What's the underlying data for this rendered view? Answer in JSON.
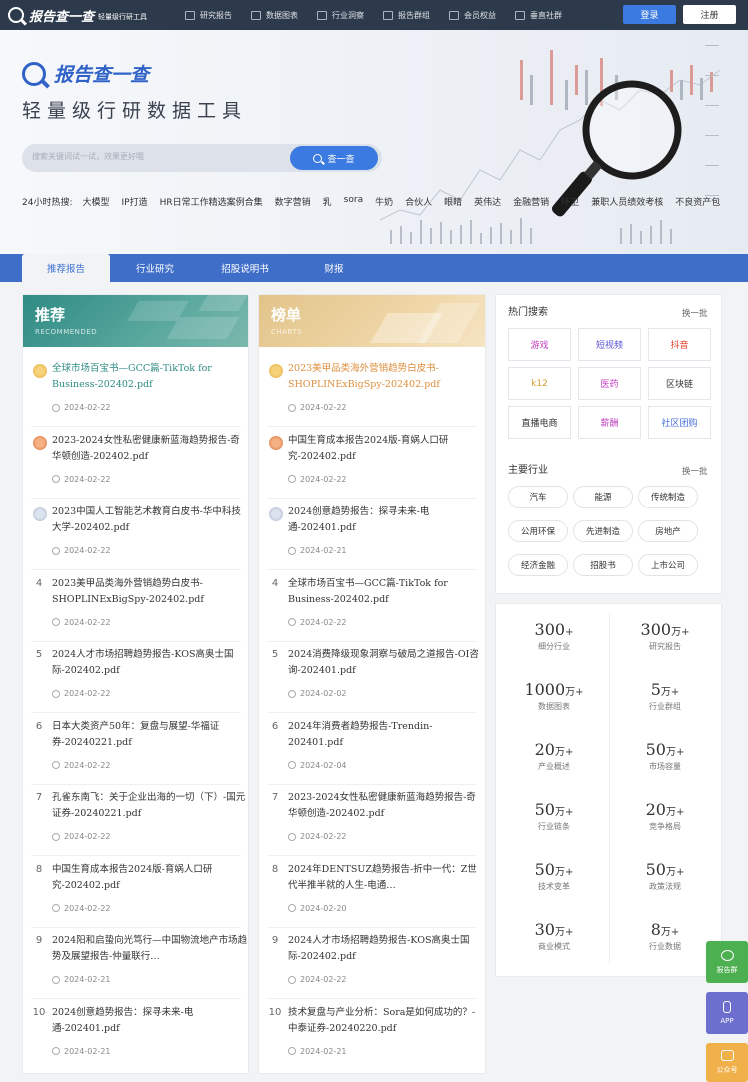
{
  "nav": {
    "logo": "报告查一查",
    "logo_sub": "轻量级行研工具",
    "items": [
      "研究报告",
      "数据图表",
      "行业洞察",
      "报告群组",
      "会员权益",
      "垂直社群"
    ],
    "login": "登录",
    "register": "注册"
  },
  "hero": {
    "brand": "报告查一查",
    "slogan": "轻量级行研数据工具",
    "search_placeholder": "搜索关键词试一试，效果更好哦",
    "search_button": "查一查",
    "hot_label": "24小时热搜:",
    "hot_words": [
      "大模型",
      "IP打造",
      "HR日常工作精选案例合集",
      "数字营销",
      "乳",
      "sora",
      "牛奶",
      "合伙人",
      "眼睛",
      "英伟达",
      "金融营销",
      "环卫",
      "兼职人员绩效考核",
      "不良资产包"
    ]
  },
  "tabs": [
    "推荐报告",
    "行业研究",
    "招股说明书",
    "财报"
  ],
  "recommend": {
    "title": "推荐",
    "subtitle": "RECOMMENDED",
    "items": [
      {
        "rank": "1",
        "title": "全球市场百宝书—GCC篇-TikTok for Business-202402.pdf",
        "date": "2024-02-22"
      },
      {
        "rank": "2",
        "title": "2023-2024女性私密健康新蓝海趋势报告-奇华顿创造-202402.pdf",
        "date": "2024-02-22"
      },
      {
        "rank": "3",
        "title": "2023中国人工智能艺术教育白皮书-华中科技大学-202402.pdf",
        "date": "2024-02-22"
      },
      {
        "rank": "4",
        "title": "2023美甲品类海外营销趋势白皮书-SHOPLINExBigSpy-202402.pdf",
        "date": "2024-02-22"
      },
      {
        "rank": "5",
        "title": "2024人才市场招聘趋势报告-KOS高奥士国际-202402.pdf",
        "date": "2024-02-22"
      },
      {
        "rank": "6",
        "title": "日本大类资产50年：复盘与展望-华福证券-20240221.pdf",
        "date": "2024-02-22"
      },
      {
        "rank": "7",
        "title": "孔雀东南飞：关于企业出海的一切（下）-国元证券-20240221.pdf",
        "date": "2024-02-22"
      },
      {
        "rank": "8",
        "title": "中国生育成本报告2024版-育娲人口研究-202402.pdf",
        "date": "2024-02-22"
      },
      {
        "rank": "9",
        "title": "2024阳和启蛰向光笃行—中国物流地产市场趋势及展望报告-仲量联行…",
        "date": "2024-02-21"
      },
      {
        "rank": "10",
        "title": "2024创意趋势报告：探寻未来-电通-202401.pdf",
        "date": "2024-02-21"
      }
    ]
  },
  "charts": {
    "title": "榜单",
    "subtitle": "CHARTS",
    "items": [
      {
        "rank": "1",
        "title": "2023美甲品类海外营销趋势白皮书-SHOPLINExBigSpy-202402.pdf",
        "date": "2024-02-22"
      },
      {
        "rank": "2",
        "title": "中国生育成本报告2024版-育娲人口研究-202402.pdf",
        "date": "2024-02-22"
      },
      {
        "rank": "3",
        "title": "2024创意趋势报告：探寻未来-电通-202401.pdf",
        "date": "2024-02-21"
      },
      {
        "rank": "4",
        "title": "全球市场百宝书—GCC篇-TikTok for Business-202402.pdf",
        "date": "2024-02-22"
      },
      {
        "rank": "5",
        "title": "2024消费降级现象洞察与破局之道报告-OI咨询-202401.pdf",
        "date": "2024-02-02"
      },
      {
        "rank": "6",
        "title": "2024年消费者趋势报告-Trendin-202401.pdf",
        "date": "2024-02-04"
      },
      {
        "rank": "7",
        "title": "2023-2024女性私密健康新蓝海趋势报告-奇华顿创造-202402.pdf",
        "date": "2024-02-22"
      },
      {
        "rank": "8",
        "title": "2024年DENTSUZ趋势报告-折中一代：Z世代半推半就的人生-电通…",
        "date": "2024-02-20"
      },
      {
        "rank": "9",
        "title": "2024人才市场招聘趋势报告-KOS高奥士国际-202402.pdf",
        "date": "2024-02-22"
      },
      {
        "rank": "10",
        "title": "技术复盘与产业分析：Sora是如何成功的？-中泰证券-20240220.pdf",
        "date": "2024-02-21"
      }
    ]
  },
  "hot_search": {
    "title": "热门搜索",
    "more": "换一批",
    "keywords": [
      {
        "text": "游戏",
        "color": "#c040c0"
      },
      {
        "text": "短视频",
        "color": "#5a4fd6"
      },
      {
        "text": "抖音",
        "color": "#e0402c"
      },
      {
        "text": "k12",
        "color": "#d79a2b"
      },
      {
        "text": "医药",
        "color": "#c040c0"
      },
      {
        "text": "区块链",
        "color": "#333333"
      },
      {
        "text": "直播电商",
        "color": "#333333"
      },
      {
        "text": "薪酬",
        "color": "#c040c0"
      },
      {
        "text": "社区团购",
        "color": "#4a6fd8"
      }
    ]
  },
  "industry": {
    "title": "主要行业",
    "more": "换一批",
    "items": [
      "汽车",
      "能源",
      "传统制造",
      "公用环保",
      "先进制造",
      "房地产",
      "经济金融",
      "招股书",
      "上市公司"
    ]
  },
  "stats": [
    {
      "num": "300",
      "unit": "+",
      "label": "细分行业"
    },
    {
      "num": "300",
      "unit": "万+",
      "label": "研究报告"
    },
    {
      "num": "1000",
      "unit": "万+",
      "label": "数据图表"
    },
    {
      "num": "5",
      "unit": "万+",
      "label": "行业群组"
    },
    {
      "num": "20",
      "unit": "万+",
      "label": "产业概述"
    },
    {
      "num": "50",
      "unit": "万+",
      "label": "市场容量"
    },
    {
      "num": "50",
      "unit": "万+",
      "label": "行业链条"
    },
    {
      "num": "20",
      "unit": "万+",
      "label": "竞争格局"
    },
    {
      "num": "50",
      "unit": "万+",
      "label": "技术变革"
    },
    {
      "num": "50",
      "unit": "万+",
      "label": "政策法规"
    },
    {
      "num": "30",
      "unit": "万+",
      "label": "商业模式"
    },
    {
      "num": "8",
      "unit": "万+",
      "label": "行业数据"
    }
  ],
  "float": {
    "group": "报告群",
    "app": "APP",
    "official": "公众号"
  }
}
